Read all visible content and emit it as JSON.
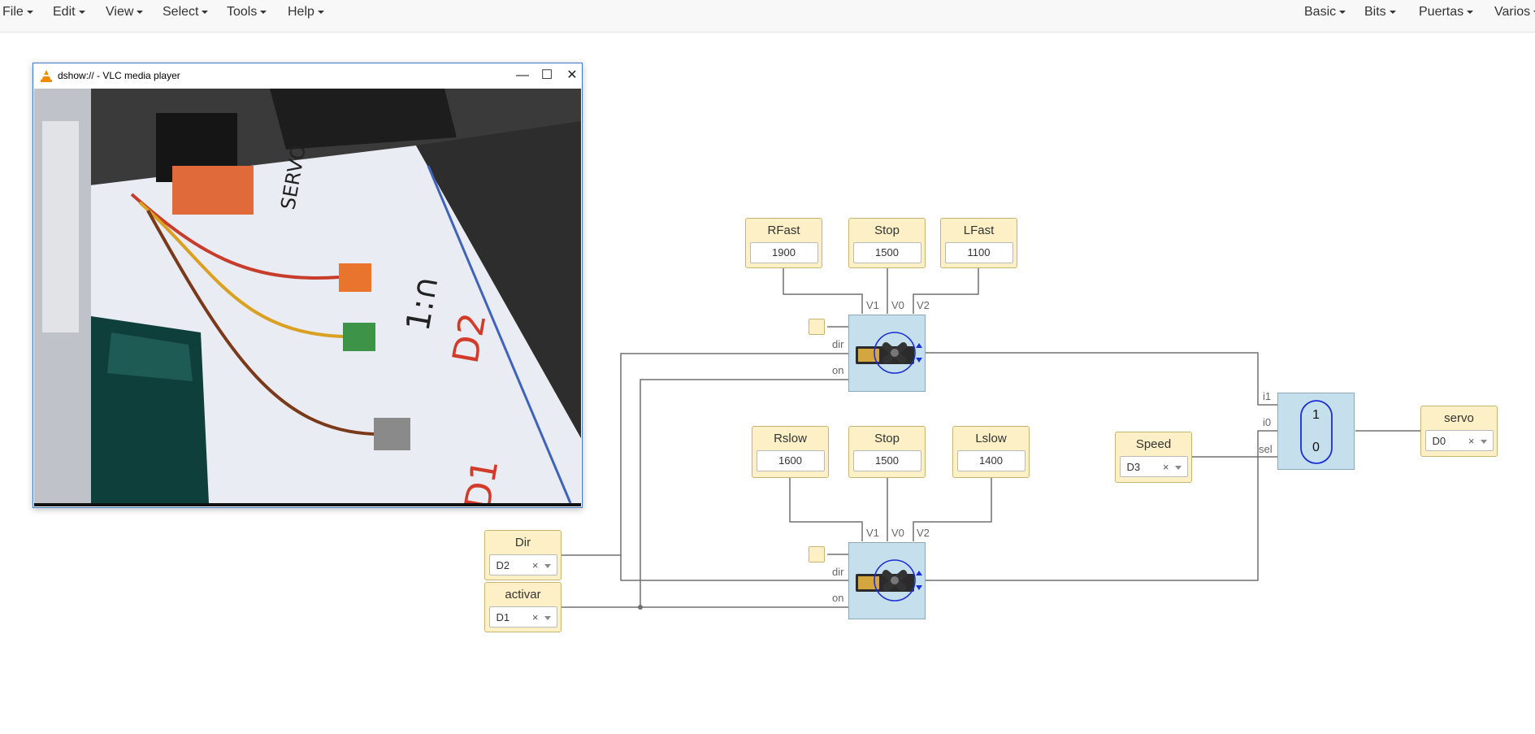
{
  "menubar": {
    "left": [
      "File",
      "Edit",
      "View",
      "Select",
      "Tools",
      "Help"
    ],
    "right": [
      "Basic",
      "Bits",
      "Puertas",
      "Varios"
    ]
  },
  "vlc": {
    "title": "dshow:// - VLC media player",
    "minimize": "—",
    "maximize": "☐",
    "close": "✕"
  },
  "blocks": {
    "rfast": {
      "label": "RFast",
      "value": "1900"
    },
    "stop_top": {
      "label": "Stop",
      "value": "1500"
    },
    "lfast": {
      "label": "LFast",
      "value": "1100"
    },
    "rslow": {
      "label": "Rslow",
      "value": "1600"
    },
    "stop_bottom": {
      "label": "Stop",
      "value": "1500"
    },
    "lslow": {
      "label": "Lslow",
      "value": "1400"
    },
    "dir": {
      "label": "Dir",
      "value": "D2",
      "clear": "×"
    },
    "activar": {
      "label": "activar",
      "value": "D1",
      "clear": "×"
    },
    "speed": {
      "label": "Speed",
      "value": "D3",
      "clear": "×"
    },
    "servo": {
      "label": "servo",
      "value": "D0",
      "clear": "×"
    }
  },
  "pins": {
    "v1": "V1",
    "v0": "V0",
    "v2": "V2",
    "dir": "dir",
    "on": "on",
    "i1": "i1",
    "i0": "i0",
    "sel": "sel"
  },
  "mux": {
    "top": "1",
    "bottom": "0"
  },
  "colors": {
    "input_block": "#fdf0c6",
    "component_block": "#c6dfec",
    "wire": "#707070",
    "mux_outline": "#1a2fd6"
  }
}
